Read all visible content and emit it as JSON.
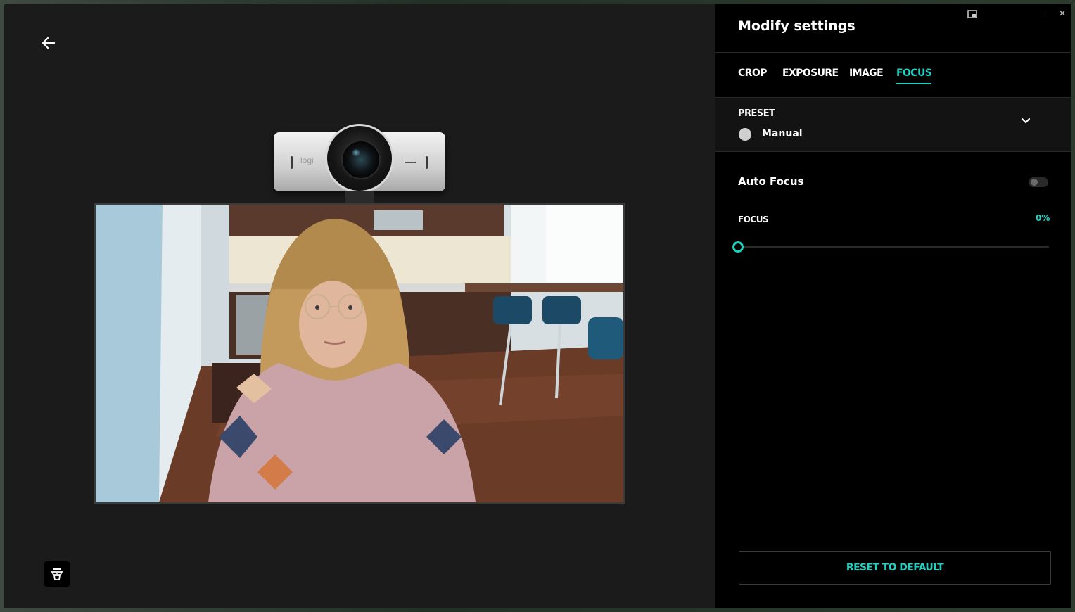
{
  "window": {
    "minimize_glyph": "–",
    "close_glyph": "✕",
    "pip_icon": "picture-in-picture-icon"
  },
  "preview": {
    "back_icon": "arrow-left-icon",
    "webcam_brand": "logi",
    "bottom_button_icon": "camera-stand-icon"
  },
  "settings": {
    "title": "Modify settings",
    "tabs": [
      {
        "label": "CROP",
        "active": false
      },
      {
        "label": "EXPOSURE",
        "active": false
      },
      {
        "label": "IMAGE",
        "active": false
      },
      {
        "label": "FOCUS",
        "active": true
      }
    ],
    "preset": {
      "label": "PRESET",
      "value": "Manual",
      "chevron_icon": "chevron-down-icon"
    },
    "auto_focus": {
      "label": "Auto Focus",
      "enabled": false
    },
    "focus": {
      "label": "FOCUS",
      "value_text": "0%",
      "value": 0
    },
    "reset_label": "RESET TO DEFAULT"
  },
  "colors": {
    "accent": "#1fd1c1",
    "panel": "#000000",
    "preview_bg": "#1b1b1b"
  }
}
